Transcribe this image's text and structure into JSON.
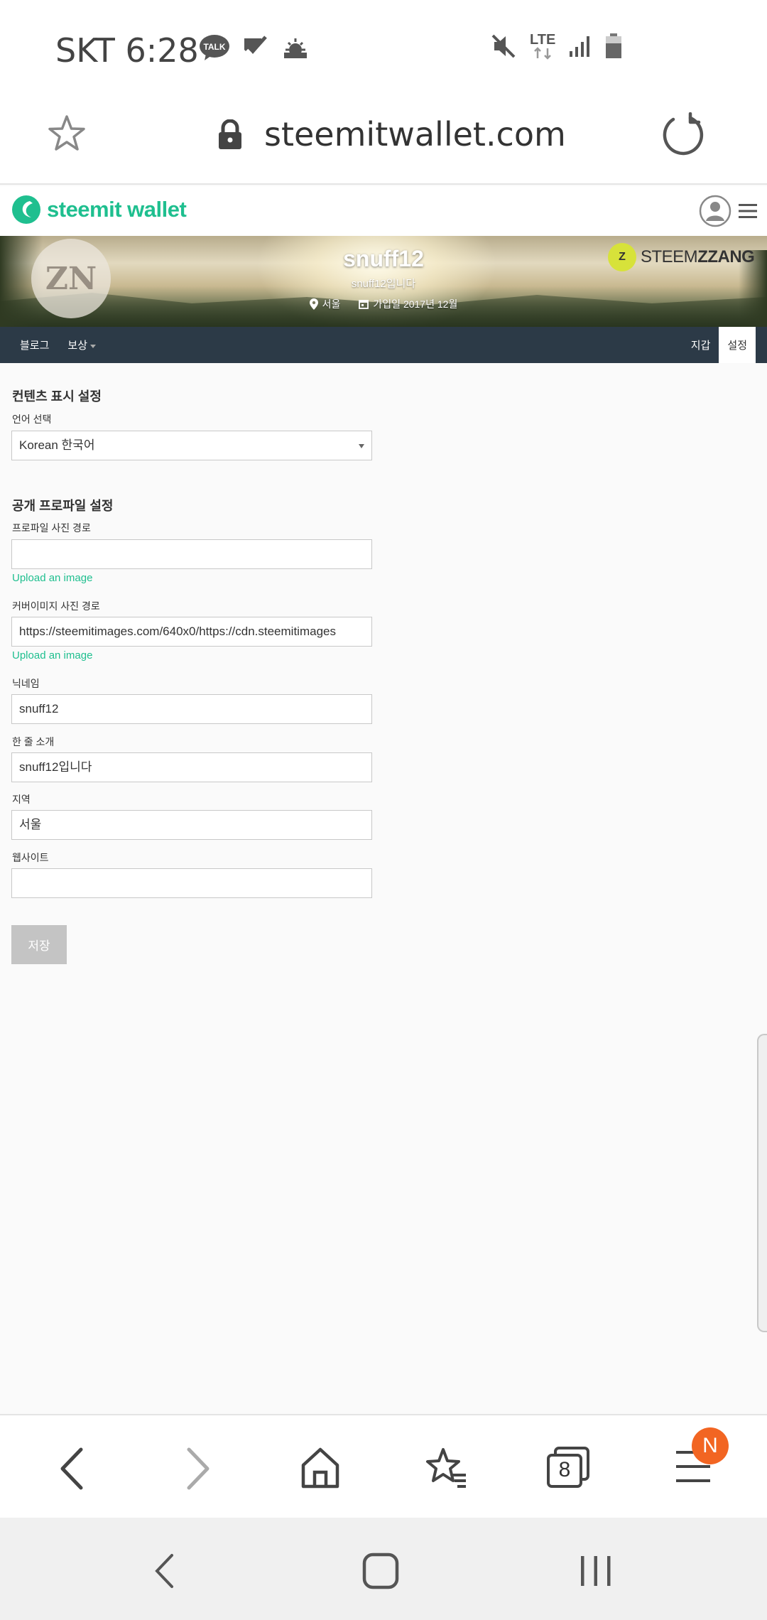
{
  "status_bar": {
    "carrier_time": "SKT 6:28",
    "talk_label": "TALK",
    "network": "LTE",
    "icons": [
      "talk-icon",
      "check-icon",
      "weather-icon",
      "mute-icon",
      "lte-icon",
      "signal-icon",
      "battery-icon"
    ]
  },
  "address_bar": {
    "url": "steemitwallet.com"
  },
  "site": {
    "logo_text": "steemit wallet"
  },
  "profile": {
    "name": "snuff12",
    "about": "snuff12입니다",
    "location": "서울",
    "joined": "가입일 2017년 12월",
    "sponsor_text_1": "STEEM",
    "sponsor_text_2": "ZZANG"
  },
  "nav": {
    "left": [
      "블로그",
      "보상"
    ],
    "right": [
      "지갑",
      "설정"
    ],
    "active": "설정"
  },
  "settings": {
    "content_section_title": "컨텐츠 표시 설정",
    "language_label": "언어 선택",
    "language_value": "Korean 한국어",
    "profile_section_title": "공개 프로파일 설정",
    "profile_image_label": "프로파일 사진 경로",
    "profile_image_value": "",
    "upload_label": "Upload an image",
    "cover_image_label": "커버이미지 사진 경로",
    "cover_image_value": "https://steemitimages.com/640x0/https://cdn.steemitimages",
    "nickname_label": "닉네임",
    "nickname_value": "snuff12",
    "about_label": "한 줄 소개",
    "about_value": "snuff12입니다",
    "location_label": "지역",
    "location_value": "서울",
    "website_label": "웹사이트",
    "website_value": "",
    "save_label": "저장"
  },
  "toolbar": {
    "tabs_count": "8",
    "notification_badge": "N"
  },
  "colors": {
    "accent": "#1fbf8f",
    "nav_bg": "#2c3a47",
    "badge": "#f26522"
  }
}
